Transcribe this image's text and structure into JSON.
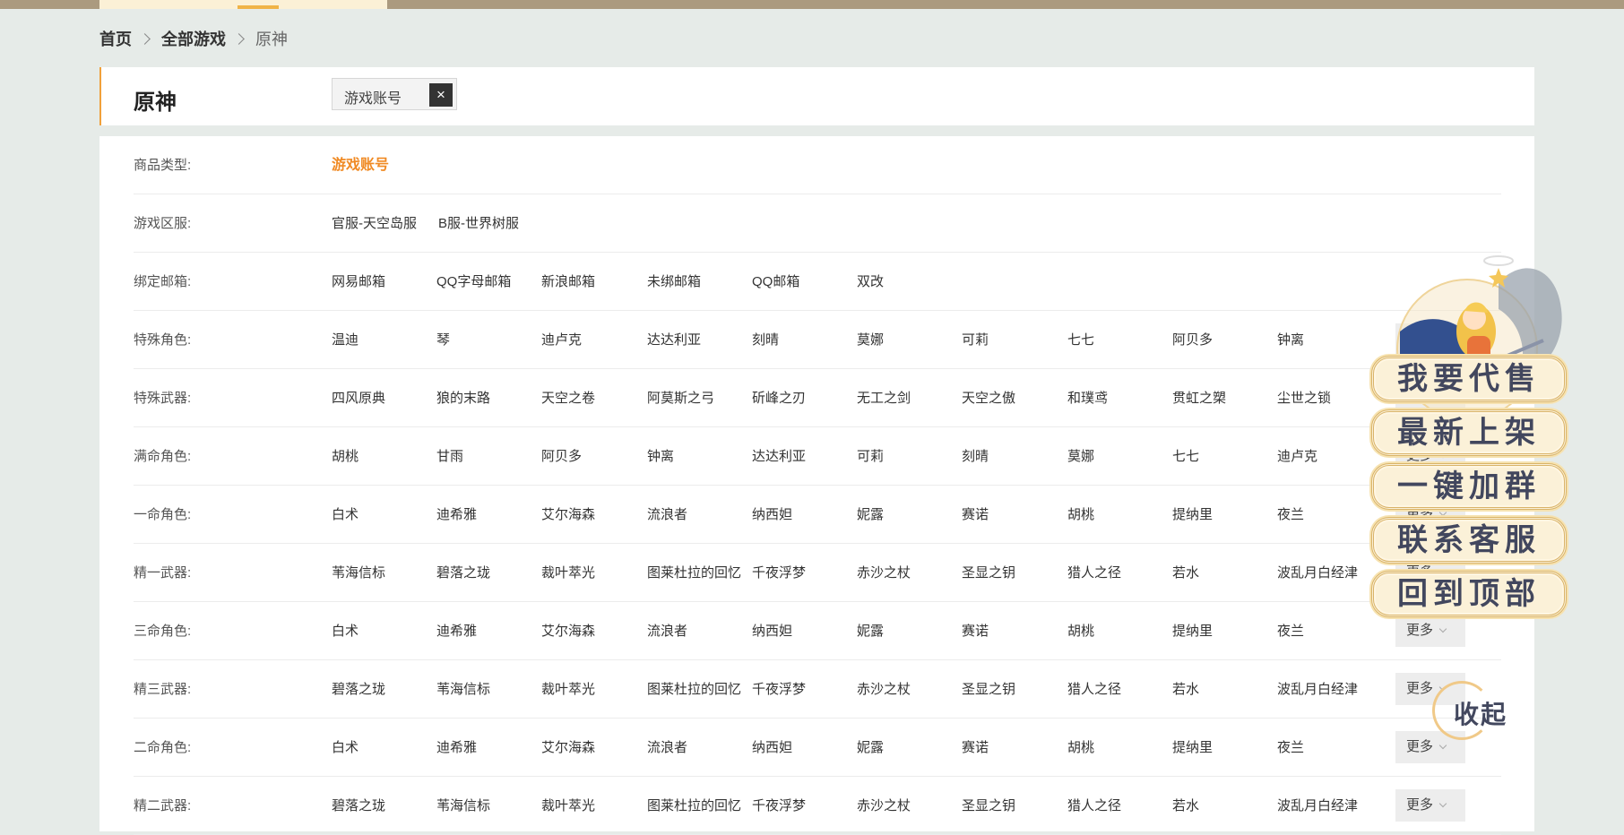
{
  "breadcrumb": {
    "home": "首页",
    "all_games": "全部游戏",
    "current": "原神"
  },
  "game": {
    "title": "原神"
  },
  "selected_filter": {
    "label": "游戏账号",
    "close_symbol": "×"
  },
  "filters": [
    {
      "label": "商品类型:",
      "options": [
        "游戏账号"
      ],
      "active": 0,
      "more": null
    },
    {
      "label": "游戏区服:",
      "options": [
        "官服-天空岛服",
        "B服-世界树服"
      ],
      "more": null
    },
    {
      "label": "绑定邮箱:",
      "options": [
        "网易邮箱",
        "QQ字母邮箱",
        "新浪邮箱",
        "未绑邮箱",
        "QQ邮箱",
        "双改"
      ],
      "more": null
    },
    {
      "label": "特殊角色:",
      "options": [
        "温迪",
        "琴",
        "迪卢克",
        "达达利亚",
        "刻晴",
        "莫娜",
        "可莉",
        "七七",
        "阿贝多",
        "钟离"
      ],
      "more": "更多"
    },
    {
      "label": "特殊武器:",
      "options": [
        "四风原典",
        "狼的末路",
        "天空之卷",
        "阿莫斯之弓",
        "斫峰之刃",
        "无工之剑",
        "天空之傲",
        "和璞鸢",
        "贯虹之槊",
        "尘世之锁"
      ],
      "more": "更多"
    },
    {
      "label": "满命角色:",
      "options": [
        "胡桃",
        "甘雨",
        "阿贝多",
        "钟离",
        "达达利亚",
        "可莉",
        "刻晴",
        "莫娜",
        "七七",
        "迪卢克"
      ],
      "more": "更多"
    },
    {
      "label": "一命角色:",
      "options": [
        "白术",
        "迪希雅",
        "艾尔海森",
        "流浪者",
        "纳西妲",
        "妮露",
        "赛诺",
        "胡桃",
        "提纳里",
        "夜兰"
      ],
      "more": "更多"
    },
    {
      "label": "精一武器:",
      "options": [
        "苇海信标",
        "碧落之珑",
        "裁叶萃光",
        "图莱杜拉的回忆",
        "千夜浮梦",
        "赤沙之杖",
        "圣显之钥",
        "猎人之径",
        "若水",
        "波乱月白经津"
      ],
      "more": "更多"
    },
    {
      "label": "三命角色:",
      "options": [
        "白术",
        "迪希雅",
        "艾尔海森",
        "流浪者",
        "纳西妲",
        "妮露",
        "赛诺",
        "胡桃",
        "提纳里",
        "夜兰"
      ],
      "more": "更多"
    },
    {
      "label": "精三武器:",
      "options": [
        "碧落之珑",
        "苇海信标",
        "裁叶萃光",
        "图莱杜拉的回忆",
        "千夜浮梦",
        "赤沙之杖",
        "圣显之钥",
        "猎人之径",
        "若水",
        "波乱月白经津"
      ],
      "more": "更多"
    },
    {
      "label": "二命角色:",
      "options": [
        "白术",
        "迪希雅",
        "艾尔海森",
        "流浪者",
        "纳西妲",
        "妮露",
        "赛诺",
        "胡桃",
        "提纳里",
        "夜兰"
      ],
      "more": "更多"
    },
    {
      "label": "精二武器:",
      "options": [
        "碧落之珑",
        "苇海信标",
        "裁叶萃光",
        "图莱杜拉的回忆",
        "千夜浮梦",
        "赤沙之杖",
        "圣显之钥",
        "猎人之径",
        "若水",
        "波乱月白经津"
      ],
      "more": "更多"
    }
  ],
  "float_menu": {
    "items": [
      "我要代售",
      "最新上架",
      "一键加群",
      "联系客服",
      "回到顶部"
    ],
    "collapse": "收起"
  },
  "colors": {
    "accent": "#f08a24",
    "topbar": "#ab9a7f",
    "background": "#e6ebe8"
  }
}
